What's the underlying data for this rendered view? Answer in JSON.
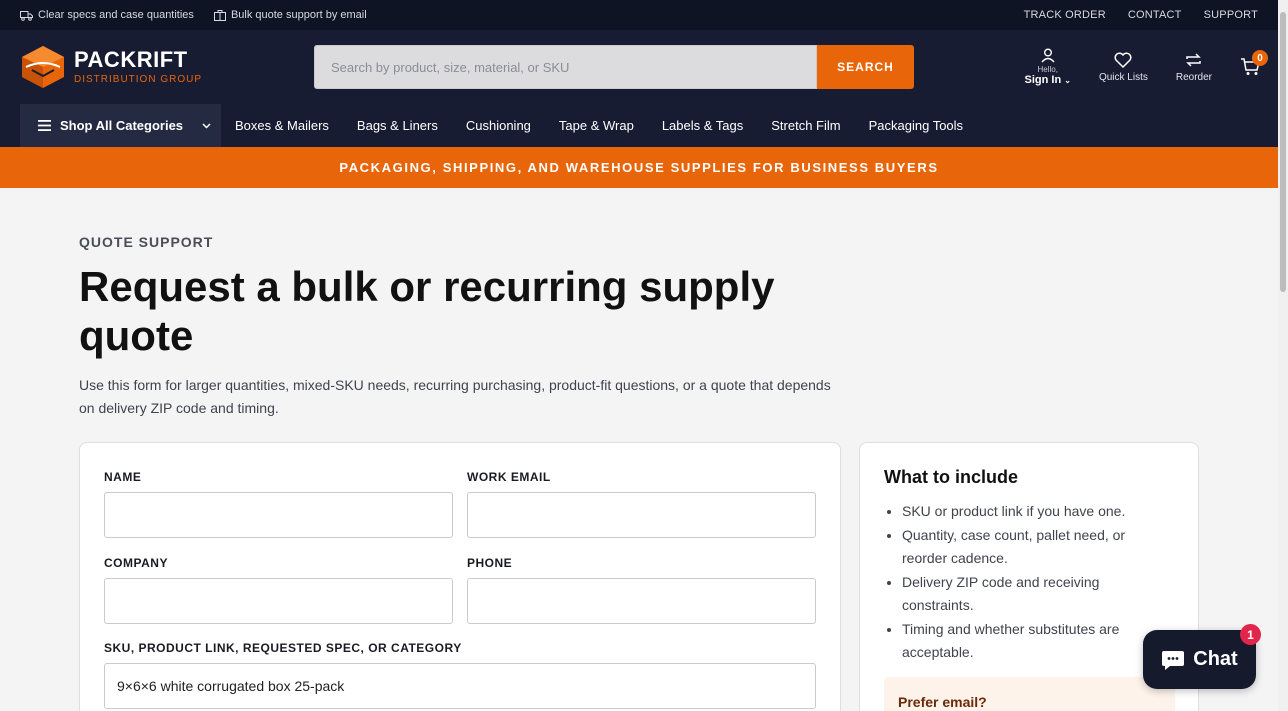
{
  "utility": {
    "left": [
      {
        "icon": "truck-icon",
        "text": "Clear specs and case quantities"
      },
      {
        "icon": "package-icon",
        "text": "Bulk quote support by email"
      }
    ],
    "links": [
      "TRACK ORDER",
      "CONTACT",
      "SUPPORT"
    ]
  },
  "header": {
    "brand": "PACKRIFT",
    "brand_sub": "DISTRIBUTION GROUP",
    "search_placeholder": "Search by product, size, material, or SKU",
    "search_button": "SEARCH",
    "account_greeting": "Hello,",
    "account_label": "Sign In",
    "quick_lists": "Quick Lists",
    "reorder": "Reorder",
    "cart_count": "0"
  },
  "nav": {
    "shop_all": "Shop All Categories",
    "links": [
      "Boxes & Mailers",
      "Bags & Liners",
      "Cushioning",
      "Tape & Wrap",
      "Labels & Tags",
      "Stretch Film",
      "Packaging Tools"
    ]
  },
  "promo": "PACKAGING, SHIPPING, AND WAREHOUSE SUPPLIES FOR BUSINESS BUYERS",
  "main": {
    "eyebrow": "QUOTE SUPPORT",
    "title": "Request a bulk or recurring supply quote",
    "intro": "Use this form for larger quantities, mixed-SKU needs, recurring purchasing, product-fit questions, or a quote that depends on delivery ZIP code and timing."
  },
  "form": {
    "name_label": "NAME",
    "name_value": "",
    "email_label": "WORK EMAIL",
    "email_value": "",
    "company_label": "COMPANY",
    "company_value": "",
    "phone_label": "PHONE",
    "phone_value": "",
    "sku_label": "SKU, PRODUCT LINK, REQUESTED SPEC, OR CATEGORY",
    "sku_value": "9×6×6 white corrugated box 25-pack"
  },
  "side": {
    "title": "What to include",
    "items": [
      "SKU or product link if you have one.",
      "Quantity, case count, pallet need, or reorder cadence.",
      "Delivery ZIP code and receiving constraints.",
      "Timing and whether substitutes are acceptable."
    ],
    "pref_title": "Prefer email?"
  },
  "chat": {
    "label": "Chat",
    "badge": "1"
  },
  "colors": {
    "accent": "#e8650a",
    "navy": "#181c33",
    "top": "#0f1424"
  }
}
